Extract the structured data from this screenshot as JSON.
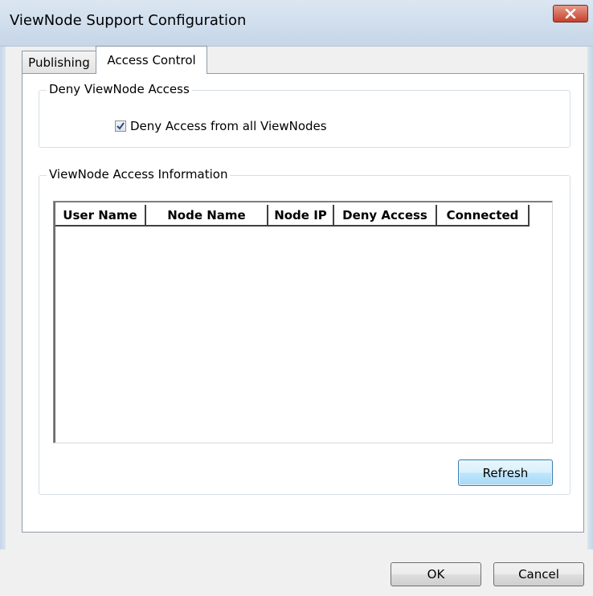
{
  "window": {
    "title": "ViewNode Support Configuration",
    "close_icon": "close-icon"
  },
  "tabs": [
    {
      "label": "Publishing",
      "selected": false
    },
    {
      "label": "Access Control",
      "selected": true
    }
  ],
  "deny_group": {
    "title": "Deny ViewNode Access",
    "checkbox_label": "Deny Access from all ViewNodes",
    "checked": true
  },
  "info_group": {
    "title": "ViewNode Access Information",
    "columns": [
      "User Name",
      "Node Name",
      "Node IP",
      "Deny Access",
      "Connected"
    ],
    "rows": [],
    "refresh_label": "Refresh"
  },
  "dialog_buttons": {
    "ok_label": "OK",
    "cancel_label": "Cancel"
  },
  "colors": {
    "close_button": "#c5412c",
    "refresh_button_border": "#3c7fb1",
    "titlebar": "#c6d6e8"
  }
}
